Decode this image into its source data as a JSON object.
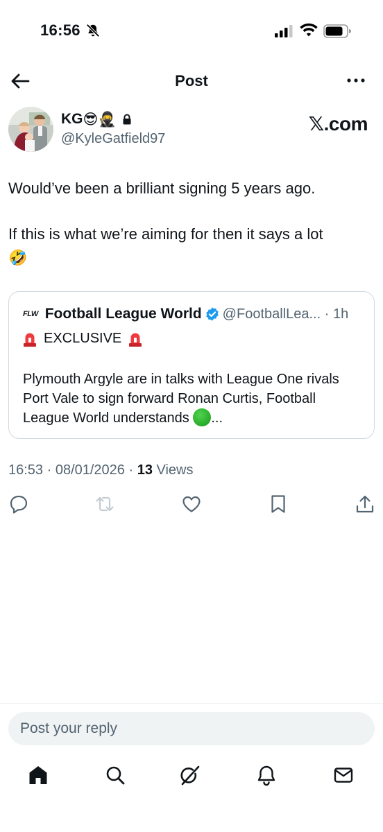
{
  "status_bar": {
    "time": "16:56"
  },
  "header": {
    "title": "Post"
  },
  "post": {
    "display_name": "KG",
    "name_emojis": [
      "😎",
      "🥷"
    ],
    "handle": "@KyleGatfield97",
    "source_label": "𝕏.com",
    "text_line1": "Would’ve been a brilliant signing 5 years ago.",
    "text_line2": "If this is what we’re aiming for then it says a lot",
    "text_emoji": "🤣",
    "timestamp": "16:53 · 08/01/2026 · ",
    "views_count": "13",
    "views_label": " Views"
  },
  "quote": {
    "logo_text": "FLW",
    "name": "Football League World",
    "handle_time": "@FootballLea... · 1h",
    "exclusive": "EXCLUSIVE",
    "body": "Plymouth Argyle are in talks with League One rivals Port Vale to sign forward Ronan Curtis, Football League World understands ",
    "ellipsis": "..."
  },
  "reply": {
    "placeholder": "Post your reply"
  },
  "icons": {
    "back": "arrow-left-icon",
    "more": "more-dots-icon",
    "reply": "reply-icon",
    "repost": "repost-icon",
    "like": "heart-icon",
    "bookmark": "bookmark-icon",
    "share": "share-icon",
    "tabs": [
      "home-icon",
      "search-icon",
      "grok-icon",
      "notifications-icon",
      "messages-icon"
    ]
  },
  "colors": {
    "text": "#0f1419",
    "muted": "#536471",
    "verified": "#1d9bf0",
    "border": "#cfd9de"
  }
}
